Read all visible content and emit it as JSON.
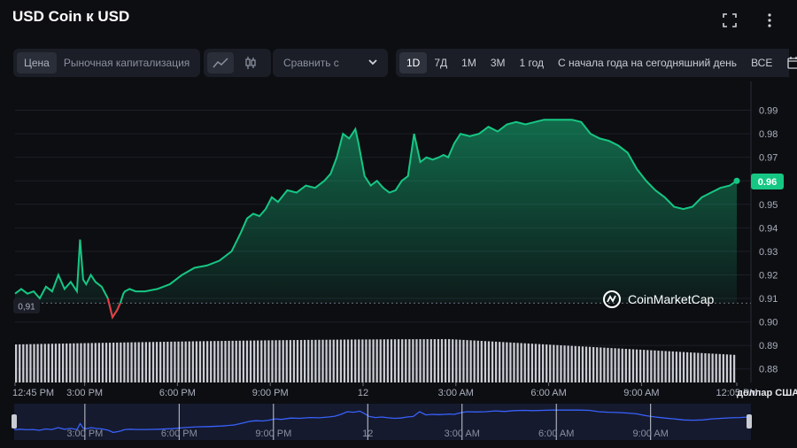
{
  "header": {
    "title": "USD Coin к USD",
    "icons": [
      "fullscreen-icon",
      "more-vertical-icon"
    ]
  },
  "toolbar": {
    "metric_tabs": [
      "Цена",
      "Рыночная капитализация"
    ],
    "active_metric": "Цена",
    "chart_types": [
      "line-chart-icon",
      "candlestick-icon"
    ],
    "compare_placeholder": "Сравнить с",
    "ranges": [
      "1D",
      "7Д",
      "1М",
      "3М",
      "1 год",
      "С начала года на сегодняшний день",
      "ВСЕ"
    ],
    "active_range": "1D",
    "calendar_icon": "calendar-icon"
  },
  "colors": {
    "up": "#16c784",
    "down": "#ea3943",
    "background": "#0d0e12",
    "navigator_line": "#3861fb"
  },
  "chart_data": {
    "type": "area",
    "ylim": [
      0.875,
      1.0
    ],
    "y_ticks": [
      "0.99",
      "0.98",
      "0.97",
      "0.96",
      "0.95",
      "0.94",
      "0.93",
      "0.92",
      "0.91",
      "0.90",
      "0.89",
      "0.88"
    ],
    "x_ticks": [
      "12:45 PM",
      "3:00 PM",
      "6:00 PM",
      "9:00 PM",
      "12",
      "3:00 AM",
      "6:00 AM",
      "9:00 AM",
      "12:05 PM"
    ],
    "x_hours": [
      0,
      2.25,
      5.25,
      8.25,
      11.25,
      14.25,
      17.25,
      20.25,
      23.33
    ],
    "start_label": "0,91",
    "start_value": 0.908,
    "current_label": "0.96",
    "current_value": 0.96,
    "currency_label": "доллар США",
    "watermark": "CoinMarketCap",
    "series": [
      {
        "x": [
          0,
          0.2,
          0.4,
          0.6,
          0.8,
          1.0,
          1.2,
          1.4,
          1.6,
          1.8,
          2.0,
          2.1,
          2.2,
          2.3,
          2.45,
          2.6,
          2.8,
          3.0,
          3.15,
          3.3,
          3.4,
          3.5,
          3.55,
          3.7,
          3.9,
          4.2,
          4.6,
          5.0,
          5.4,
          5.8,
          6.2,
          6.6,
          7.0,
          7.3,
          7.5,
          7.7,
          7.9,
          8.1,
          8.3,
          8.5,
          8.8,
          9.1,
          9.4,
          9.7,
          10.0,
          10.2,
          10.4,
          10.6,
          10.8,
          11.0,
          11.1,
          11.3,
          11.5,
          11.7,
          11.9,
          12.1,
          12.3,
          12.5,
          12.7,
          12.9,
          13.1,
          13.3,
          13.5,
          13.7,
          13.85,
          14.0,
          14.2,
          14.4,
          14.7,
          15.0,
          15.3,
          15.6,
          15.9,
          16.2,
          16.5,
          16.8,
          17.1,
          17.4,
          17.7,
          18.0,
          18.3,
          18.6,
          18.9,
          19.2,
          19.5,
          19.8,
          20.1,
          20.4,
          20.7,
          21.0,
          21.3,
          21.6,
          21.9,
          22.2,
          22.5,
          22.8,
          23.1,
          23.33
        ],
        "y": [
          0.912,
          0.914,
          0.912,
          0.913,
          0.91,
          0.915,
          0.913,
          0.92,
          0.914,
          0.917,
          0.913,
          0.935,
          0.918,
          0.916,
          0.92,
          0.917,
          0.915,
          0.91,
          0.902,
          0.905,
          0.908,
          0.912,
          0.913,
          0.914,
          0.913,
          0.913,
          0.914,
          0.916,
          0.92,
          0.923,
          0.924,
          0.926,
          0.93,
          0.938,
          0.944,
          0.946,
          0.945,
          0.948,
          0.953,
          0.951,
          0.956,
          0.955,
          0.958,
          0.957,
          0.96,
          0.963,
          0.97,
          0.98,
          0.978,
          0.982,
          0.976,
          0.962,
          0.958,
          0.96,
          0.957,
          0.955,
          0.956,
          0.96,
          0.962,
          0.98,
          0.968,
          0.97,
          0.969,
          0.97,
          0.971,
          0.97,
          0.976,
          0.98,
          0.979,
          0.98,
          0.983,
          0.981,
          0.984,
          0.985,
          0.984,
          0.985,
          0.986,
          0.986,
          0.986,
          0.986,
          0.985,
          0.98,
          0.978,
          0.977,
          0.975,
          0.972,
          0.965,
          0.96,
          0.956,
          0.953,
          0.949,
          0.948,
          0.949,
          0.953,
          0.955,
          0.957,
          0.958,
          0.96
        ]
      }
    ]
  }
}
